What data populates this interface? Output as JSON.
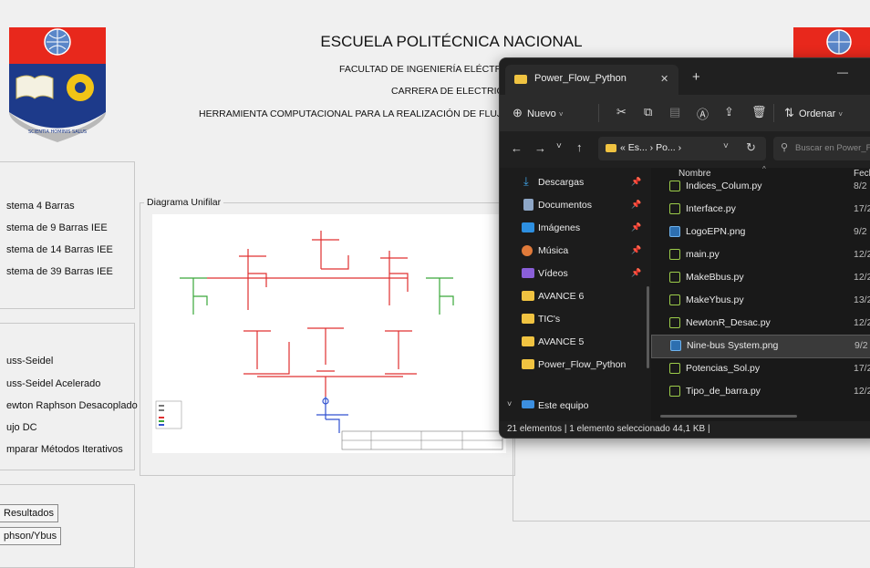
{
  "app": {
    "institution": "ESCUELA POLITÉCNICA NACIONAL",
    "faculty": "FACULTAD DE INGENIERÍA ELÉCTRICA Y E",
    "career": "CARRERA DE ELECTRICIDAD",
    "tool": "HERRAMIENTA COMPUTACIONAL PARA LA REALIZACIÓN DE FLUJOS DE POTE",
    "logo_motto": "SCIENTIA HOMINIS SALUS",
    "systems": [
      "stema 4 Barras",
      "stema de 9 Barras IEE",
      "stema de 14 Barras IEE",
      "stema de 39 Barras IEE"
    ],
    "methods": [
      "uss-Seidel",
      "uss-Seidel Acelerado",
      "ewton Raphson Desacoplado",
      "ujo DC",
      "mparar Métodos Iterativos"
    ],
    "diagram_legend": "Diagrama Unifilar",
    "buttons": [
      "Resultados",
      "phson/Ybus"
    ],
    "colors": {
      "window_bg": "#f0f0f0",
      "red_line": "#e03030",
      "green_line": "#3aa83a",
      "blue_line": "#3050d0"
    }
  },
  "explorer": {
    "tab_title": "Power_Flow_Python",
    "tab_close": "✕",
    "new_tab": "+",
    "minimize": "—",
    "new_button": "Nuevo",
    "sort_button": "Ordenar",
    "breadcrumb": "« Es... › Po... ›",
    "search_placeholder": "Buscar en Power_Fl",
    "column_name": "Nombre",
    "column_date": "Fech",
    "nav_items": [
      {
        "label": "Descargas",
        "icon": "download-icon",
        "pinned": true
      },
      {
        "label": "Documentos",
        "icon": "documents-icon",
        "pinned": true
      },
      {
        "label": "Imágenes",
        "icon": "pictures-icon",
        "pinned": true
      },
      {
        "label": "Música",
        "icon": "music-icon",
        "pinned": true
      },
      {
        "label": "Vídeos",
        "icon": "videos-icon",
        "pinned": true
      },
      {
        "label": "AVANCE 6",
        "icon": "folder-icon",
        "pinned": false
      },
      {
        "label": "TIC's",
        "icon": "folder-icon",
        "pinned": false
      },
      {
        "label": "AVANCE 5",
        "icon": "folder-icon",
        "pinned": false
      },
      {
        "label": "Power_Flow_Python",
        "icon": "folder-icon",
        "pinned": false
      },
      {
        "label": "Este equipo",
        "icon": "computer-icon",
        "pinned": false
      }
    ],
    "files": [
      {
        "name": "Indices_Colum.py",
        "date": "8/2",
        "type": "py"
      },
      {
        "name": "Interface.py",
        "date": "17/2",
        "type": "py"
      },
      {
        "name": "LogoEPN.png",
        "date": "9/2",
        "type": "png"
      },
      {
        "name": "main.py",
        "date": "12/2",
        "type": "py"
      },
      {
        "name": "MakeBbus.py",
        "date": "12/2",
        "type": "py"
      },
      {
        "name": "MakeYbus.py",
        "date": "13/2",
        "type": "py"
      },
      {
        "name": "NewtonR_Desac.py",
        "date": "12/2",
        "type": "py"
      },
      {
        "name": "Nine-bus System.png",
        "date": "9/2",
        "type": "png",
        "selected": true
      },
      {
        "name": "Potencias_Sol.py",
        "date": "17/2",
        "type": "py"
      },
      {
        "name": "Tipo_de_barra.py",
        "date": "12/2",
        "type": "py"
      }
    ],
    "status": "21 elementos  |  1 elemento seleccionado  44,1 KB  |"
  }
}
